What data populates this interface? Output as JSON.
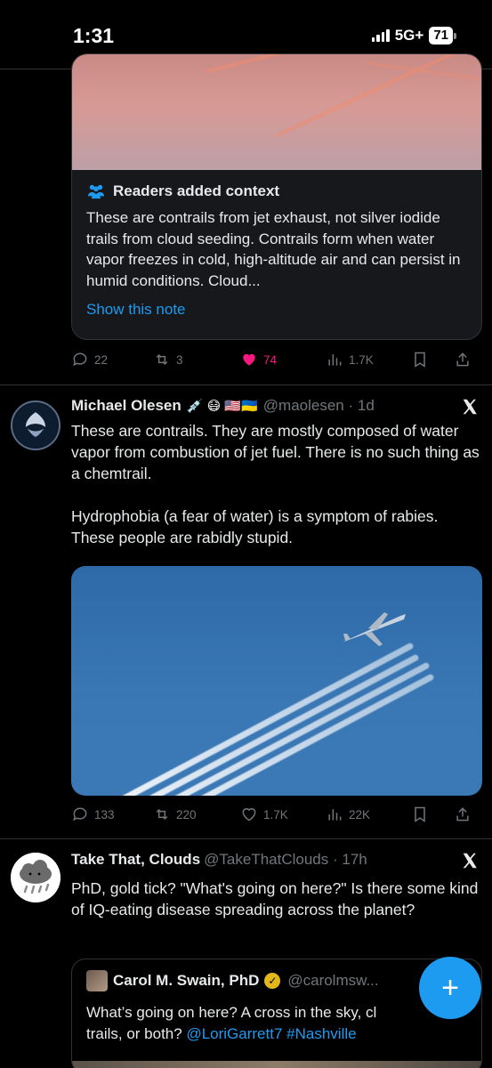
{
  "status_bar": {
    "time": "1:31",
    "network": "5G+",
    "battery": "71"
  },
  "community_note": {
    "header": "Readers added context",
    "text": "These are contrails from jet exhaust, not silver iodide trails from cloud seeding. Contrails form when water vapor freezes in cold, high-altitude air and can persist in humid conditions. Cloud...",
    "show_link": "Show this note"
  },
  "note_actions": {
    "replies": "22",
    "reposts": "3",
    "likes": "74",
    "views": "1.7K"
  },
  "tweet1": {
    "name": "Michael Olesen",
    "emojis": "💉 😷 🇺🇸🇺🇦",
    "handle": "@maolesen · 1d",
    "paragraph1": "These are contrails. They are mostly composed of water vapor from combustion of jet fuel. There is no such thing as a chemtrail.",
    "paragraph2": "Hydrophobia (a fear of water) is a symptom of rabies. These people are rabidly stupid.",
    "actions": {
      "replies": "133",
      "reposts": "220",
      "likes": "1.7K",
      "views": "22K"
    }
  },
  "tweet2": {
    "name": "Take That, Clouds",
    "handle": "@TakeThatClouds · 17h",
    "text": "PhD, gold tick? \"What's going on here?\" Is there some kind of IQ-eating disease spreading across the planet?",
    "quote": {
      "name": "Carol M. Swain, PhD",
      "handle": "@carolmsw...",
      "text_start": "What’s going on here? A cross in the sky, cl",
      "text_line2_start": "trails, or both? ",
      "mention": "@LoriGarrett7",
      "hashtag": "#Nashville"
    }
  },
  "colors": {
    "accent": "#1d9bf0",
    "like_active": "#f91880",
    "muted": "#71767b",
    "verified_gold": "#e2b719"
  }
}
